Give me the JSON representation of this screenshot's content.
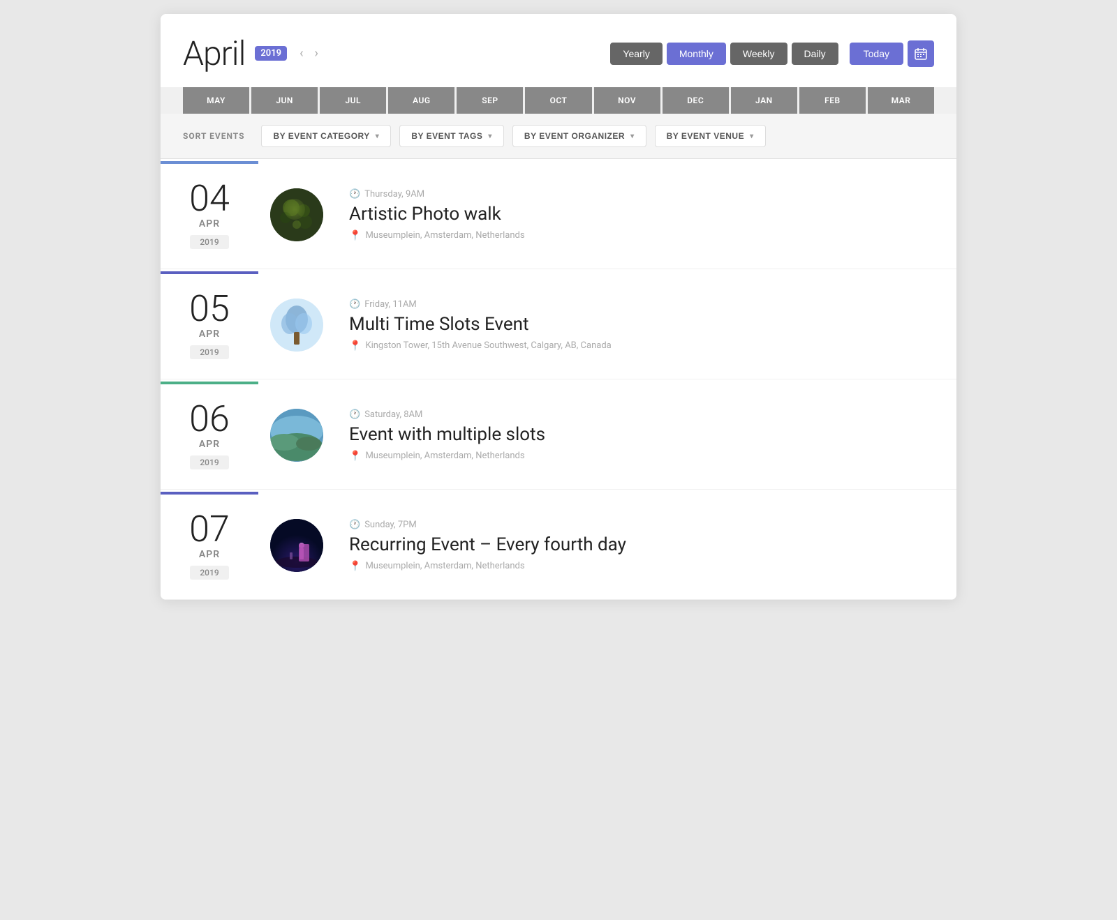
{
  "header": {
    "month": "April",
    "year": "2019",
    "nav_prev": "‹",
    "nav_next": "›"
  },
  "view_buttons": [
    {
      "label": "Yearly",
      "active": false
    },
    {
      "label": "Monthly",
      "active": true
    },
    {
      "label": "Weekly",
      "active": false
    },
    {
      "label": "Daily",
      "active": false
    }
  ],
  "today_button": "Today",
  "month_tabs": [
    "MAY",
    "JUN",
    "JUL",
    "AUG",
    "SEP",
    "OCT",
    "NOV",
    "DEC",
    "JAN",
    "FEB",
    "MAR"
  ],
  "filter_bar": {
    "sort_label": "SORT EVENTS",
    "filters": [
      {
        "label": "BY EVENT CATEGORY",
        "id": "category"
      },
      {
        "label": "BY EVENT TAGS",
        "id": "tags"
      },
      {
        "label": "BY EVENT ORGANIZER",
        "id": "organizer"
      },
      {
        "label": "BY EVENT VENUE",
        "id": "venue"
      }
    ]
  },
  "events": [
    {
      "day": "04",
      "month": "APR",
      "year": "2019",
      "time": "Thursday, 9AM",
      "title": "Artistic Photo walk",
      "location": "Museumplein, Amsterdam, Netherlands",
      "bar_color": "blue-bar",
      "thumb_type": "photo-walk"
    },
    {
      "day": "05",
      "month": "APR",
      "year": "2019",
      "time": "Friday, 11AM",
      "title": "Multi Time Slots Event",
      "location": "Kingston Tower, 15th Avenue Southwest, Calgary, AB, Canada",
      "bar_color": "indigo-bar",
      "thumb_type": "multi-slots"
    },
    {
      "day": "06",
      "month": "APR",
      "year": "2019",
      "time": "Saturday, 8AM",
      "title": "Event with multiple slots",
      "location": "Museumplein, Amsterdam, Netherlands",
      "bar_color": "green-bar",
      "thumb_type": "event-slots"
    },
    {
      "day": "07",
      "month": "APR",
      "year": "2019",
      "time": "Sunday, 7PM",
      "title": "Recurring Event – Every fourth day",
      "location": "Museumplein, Amsterdam, Netherlands",
      "bar_color": "purple-bar",
      "thumb_type": "recurring"
    }
  ]
}
